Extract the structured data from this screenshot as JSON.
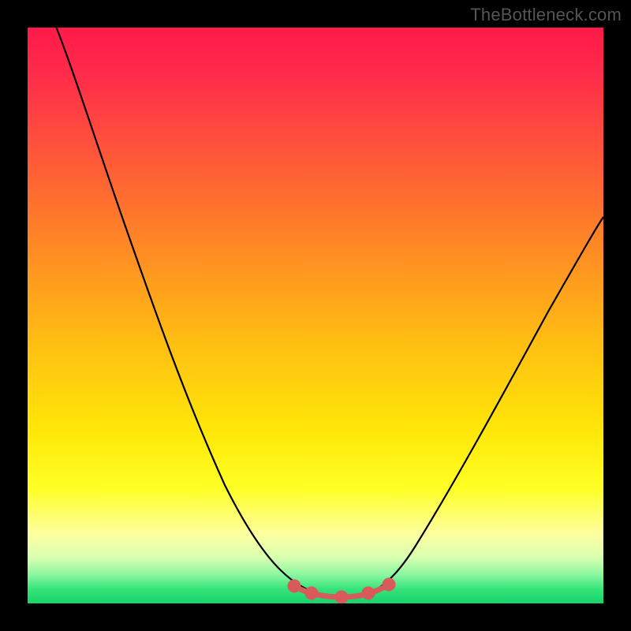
{
  "watermark": "TheBottleneck.com",
  "colors": {
    "frame": "#000000",
    "curve_stroke": "#000000",
    "marker_stroke": "#d85a5a",
    "marker_fill": "#d85a5a",
    "gradient_stops": [
      "#ff1a4a",
      "#ff2b4a",
      "#ff4a3f",
      "#ff6f2e",
      "#ff9620",
      "#ffbf12",
      "#ffe708",
      "#ffff25",
      "#fdffa0",
      "#d8ffb0",
      "#8cf7a0",
      "#35e47a",
      "#17d36b"
    ]
  },
  "chart_data": {
    "type": "line",
    "title": "",
    "xlabel": "",
    "ylabel": "",
    "xlim": [
      0,
      100
    ],
    "ylim": [
      0,
      100
    ],
    "grid": false,
    "legend": false,
    "series": [
      {
        "name": "bottleneck-curve",
        "x": [
          5,
          10,
          15,
          20,
          25,
          30,
          35,
          40,
          45,
          48,
          50,
          52,
          54,
          56,
          58,
          60,
          63,
          66,
          70,
          75,
          80,
          85,
          90,
          95,
          100
        ],
        "y": [
          100,
          90,
          80,
          69,
          58,
          47,
          36,
          26,
          15,
          9,
          5,
          2,
          1,
          1,
          1,
          2,
          4,
          8,
          14,
          22,
          31,
          40,
          49,
          58,
          67
        ]
      }
    ],
    "annotations": [
      {
        "name": "sweet-spot-markers",
        "x": [
          48,
          50,
          52,
          54,
          56,
          58,
          60,
          62
        ],
        "y": [
          3.5,
          2.2,
          1.4,
          1.1,
          1.1,
          1.4,
          2.2,
          3.5
        ]
      }
    ],
    "background_gradient": {
      "orientation": "vertical",
      "meaning": "top=high bottleneck (red), bottom=low bottleneck (green)"
    }
  }
}
